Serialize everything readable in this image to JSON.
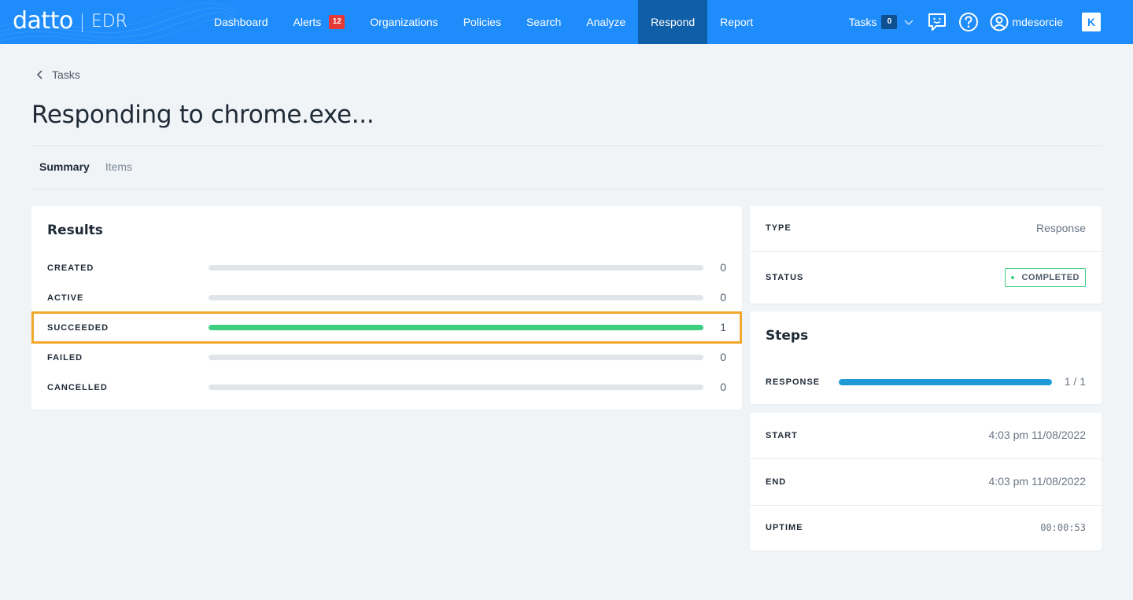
{
  "header": {
    "brand": "datto",
    "product": "EDR",
    "nav": [
      {
        "label": "Dashboard"
      },
      {
        "label": "Alerts",
        "badge": "12"
      },
      {
        "label": "Organizations"
      },
      {
        "label": "Policies"
      },
      {
        "label": "Search"
      },
      {
        "label": "Analyze"
      },
      {
        "label": "Respond",
        "active": true
      },
      {
        "label": "Report"
      }
    ],
    "tasks_label": "Tasks",
    "tasks_count": "0",
    "username": "mdesorcie",
    "icons": [
      "chevron-down-icon",
      "feedback-icon",
      "help-icon",
      "user-icon",
      "kaseya-icon"
    ],
    "kaseya_glyph": "K"
  },
  "breadcrumb": {
    "back_label": "Tasks"
  },
  "page_title": "Responding to chrome.exe...",
  "tabs": [
    {
      "label": "Summary",
      "active": true
    },
    {
      "label": "Items",
      "active": false
    }
  ],
  "results": {
    "title": "Results",
    "rows": [
      {
        "label": "CREATED",
        "value": "0",
        "fraction": 0
      },
      {
        "label": "ACTIVE",
        "value": "0",
        "fraction": 0
      },
      {
        "label": "SUCCEEDED",
        "value": "1",
        "fraction": 1
      },
      {
        "label": "FAILED",
        "value": "0",
        "fraction": 0
      },
      {
        "label": "CANCELLED",
        "value": "0",
        "fraction": 0
      }
    ]
  },
  "info": {
    "type_label": "TYPE",
    "type_value": "Response",
    "status_label": "STATUS",
    "status_value": "COMPLETED"
  },
  "steps": {
    "title": "Steps",
    "label": "RESPONSE",
    "value": "1 / 1",
    "fraction": 1
  },
  "timing": {
    "start_label": "START",
    "start_value": "4:03 pm 11/08/2022",
    "end_label": "END",
    "end_value": "4:03 pm 11/08/2022",
    "uptime_label": "UPTIME",
    "uptime_value": "00:00:53"
  },
  "colors": {
    "topbar": "#1e8cfa",
    "nav_active": "#0f5ea8",
    "alert_badge": "#e53935",
    "success": "#3ccf7f",
    "steps_bar": "#1f9ad6",
    "highlight": "#f2a82c"
  }
}
